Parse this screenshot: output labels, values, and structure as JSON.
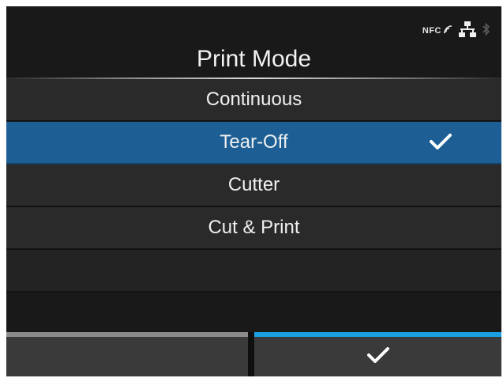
{
  "status": {
    "nfc_label": "NFC",
    "icons": [
      "nfc-icon",
      "network-icon",
      "bluetooth-icon"
    ]
  },
  "screen": {
    "title": "Print Mode"
  },
  "menu": {
    "items": [
      {
        "label": "Continuous",
        "selected": false
      },
      {
        "label": "Tear-Off",
        "selected": true
      },
      {
        "label": "Cutter",
        "selected": false
      },
      {
        "label": "Cut & Print",
        "selected": false
      }
    ]
  },
  "footer": {
    "left_button": "",
    "right_button_icon": "check-icon"
  },
  "colors": {
    "selected_row": "#1d5f95",
    "accent_bar": "#1aa0e3",
    "neutral_bar": "#8c8c8c",
    "background": "#191919"
  }
}
